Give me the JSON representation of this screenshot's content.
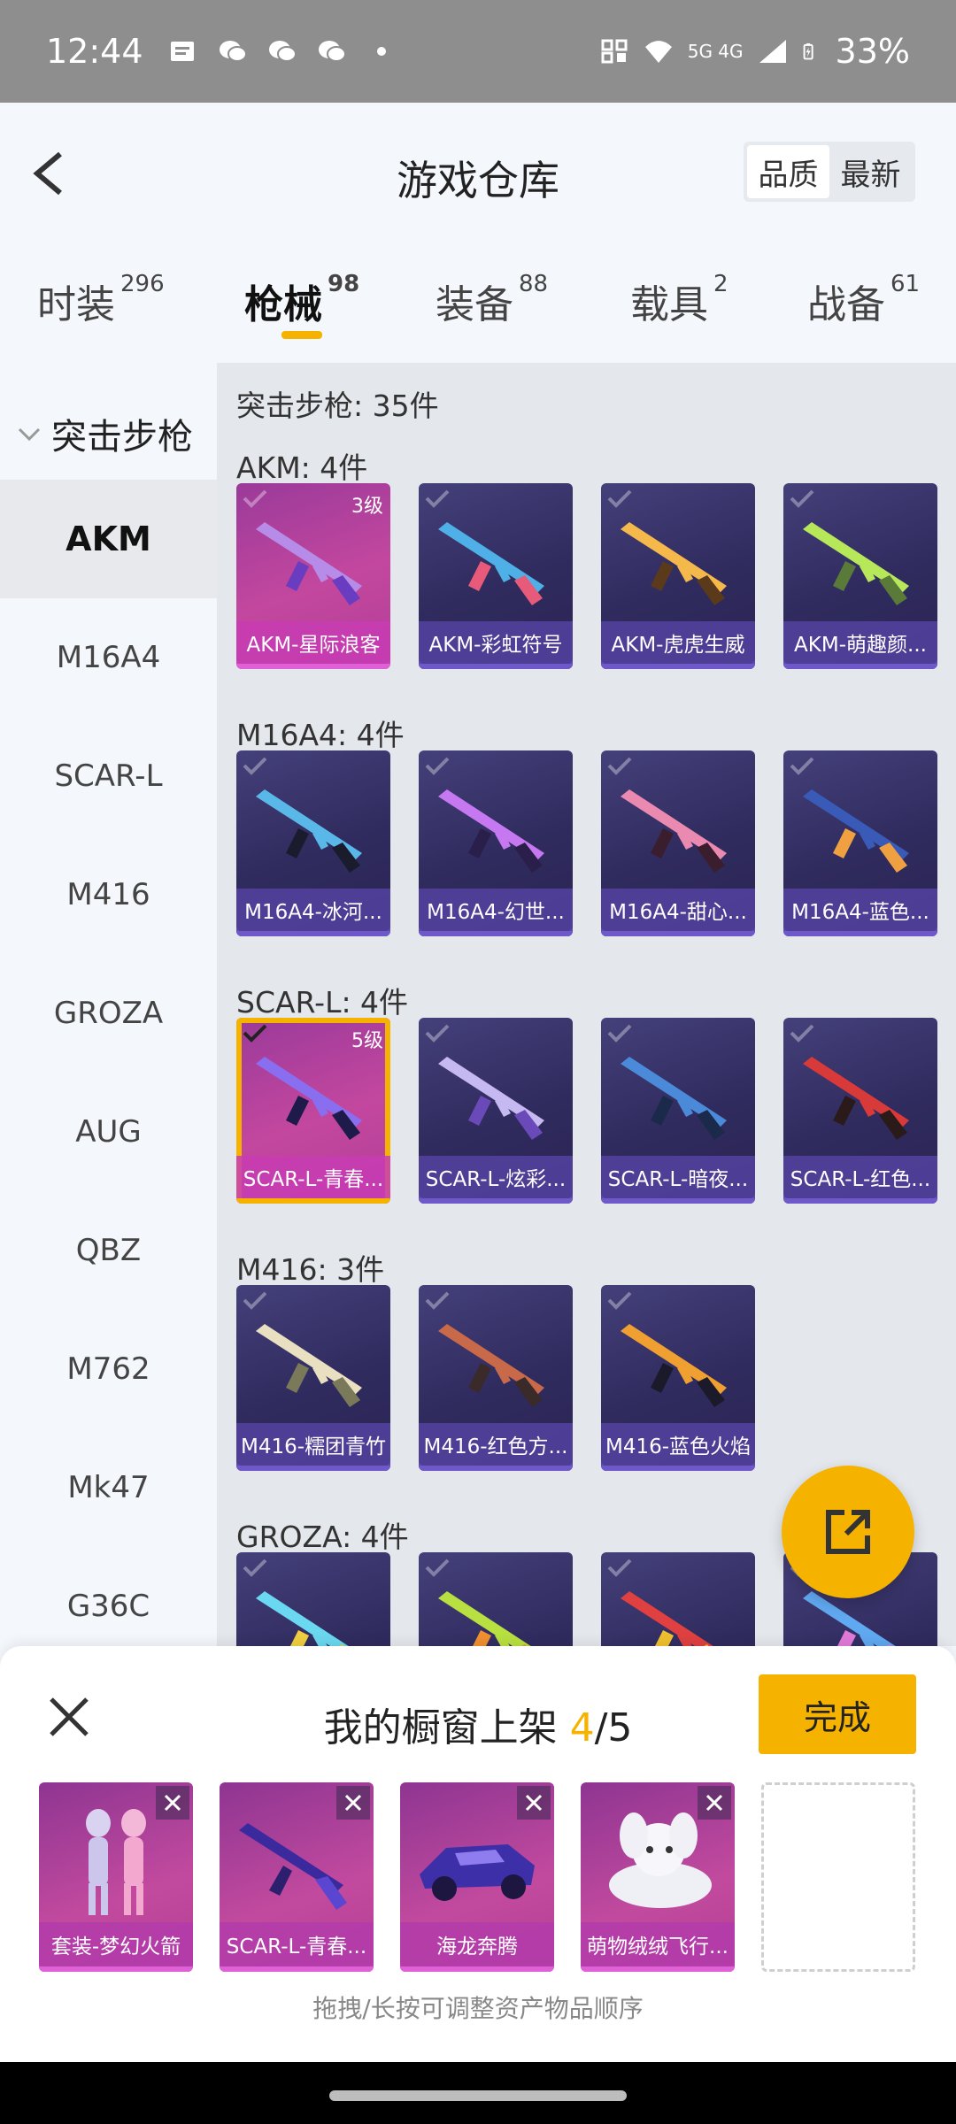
{
  "status_bar": {
    "time": "12:44",
    "network": "5G 4G",
    "battery": "33%"
  },
  "header": {
    "title": "游戏仓库",
    "sort_options": [
      "品质",
      "最新"
    ],
    "active_sort": "品质"
  },
  "tabs": [
    {
      "label": "时装",
      "count": "296"
    },
    {
      "label": "枪械",
      "count": "98"
    },
    {
      "label": "装备",
      "count": "88"
    },
    {
      "label": "载具",
      "count": "2"
    },
    {
      "label": "战备",
      "count": "61"
    }
  ],
  "sidebar": {
    "category": "突击步枪",
    "items": [
      "AKM",
      "M16A4",
      "SCAR-L",
      "M416",
      "GROZA",
      "AUG",
      "QBZ",
      "M762",
      "Mk47",
      "G36C"
    ],
    "active": "AKM"
  },
  "content": {
    "summary": "突击步枪: 35件",
    "sections": [
      {
        "label": "AKM: 4件",
        "items": [
          {
            "name": "AKM-星际浪客",
            "level": "3级"
          },
          {
            "name": "AKM-彩虹符号"
          },
          {
            "name": "AKM-虎虎生威"
          },
          {
            "name": "AKM-萌趣颜..."
          }
        ]
      },
      {
        "label": "M16A4: 4件",
        "items": [
          {
            "name": "M16A4-冰河..."
          },
          {
            "name": "M16A4-幻世..."
          },
          {
            "name": "M16A4-甜心..."
          },
          {
            "name": "M16A4-蓝色..."
          }
        ]
      },
      {
        "label": "SCAR-L: 4件",
        "items": [
          {
            "name": "SCAR-L-青春...",
            "level": "5级"
          },
          {
            "name": "SCAR-L-炫彩..."
          },
          {
            "name": "SCAR-L-暗夜..."
          },
          {
            "name": "SCAR-L-红色..."
          }
        ]
      },
      {
        "label": "M416: 3件",
        "items": [
          {
            "name": "M416-糯团青竹"
          },
          {
            "name": "M416-红色方..."
          },
          {
            "name": "M416-蓝色火焰"
          }
        ]
      },
      {
        "label": "GROZA: 4件",
        "items": [
          {
            "name": ""
          },
          {
            "name": ""
          },
          {
            "name": ""
          },
          {
            "name": ""
          }
        ]
      }
    ]
  },
  "panel": {
    "title_prefix": "我的橱窗上架 ",
    "count": "4",
    "total": "/5",
    "done_label": "完成",
    "slots": [
      "套装-梦幻火箭",
      "SCAR-L-青春...",
      "海龙奔腾",
      "萌物绒绒飞行..."
    ],
    "hint": "拖拽/长按可调整资产物品顺序"
  },
  "colors": {
    "accent": "#f5b300",
    "card_purple": "#302b5e",
    "card_pink": "#c3479e"
  }
}
